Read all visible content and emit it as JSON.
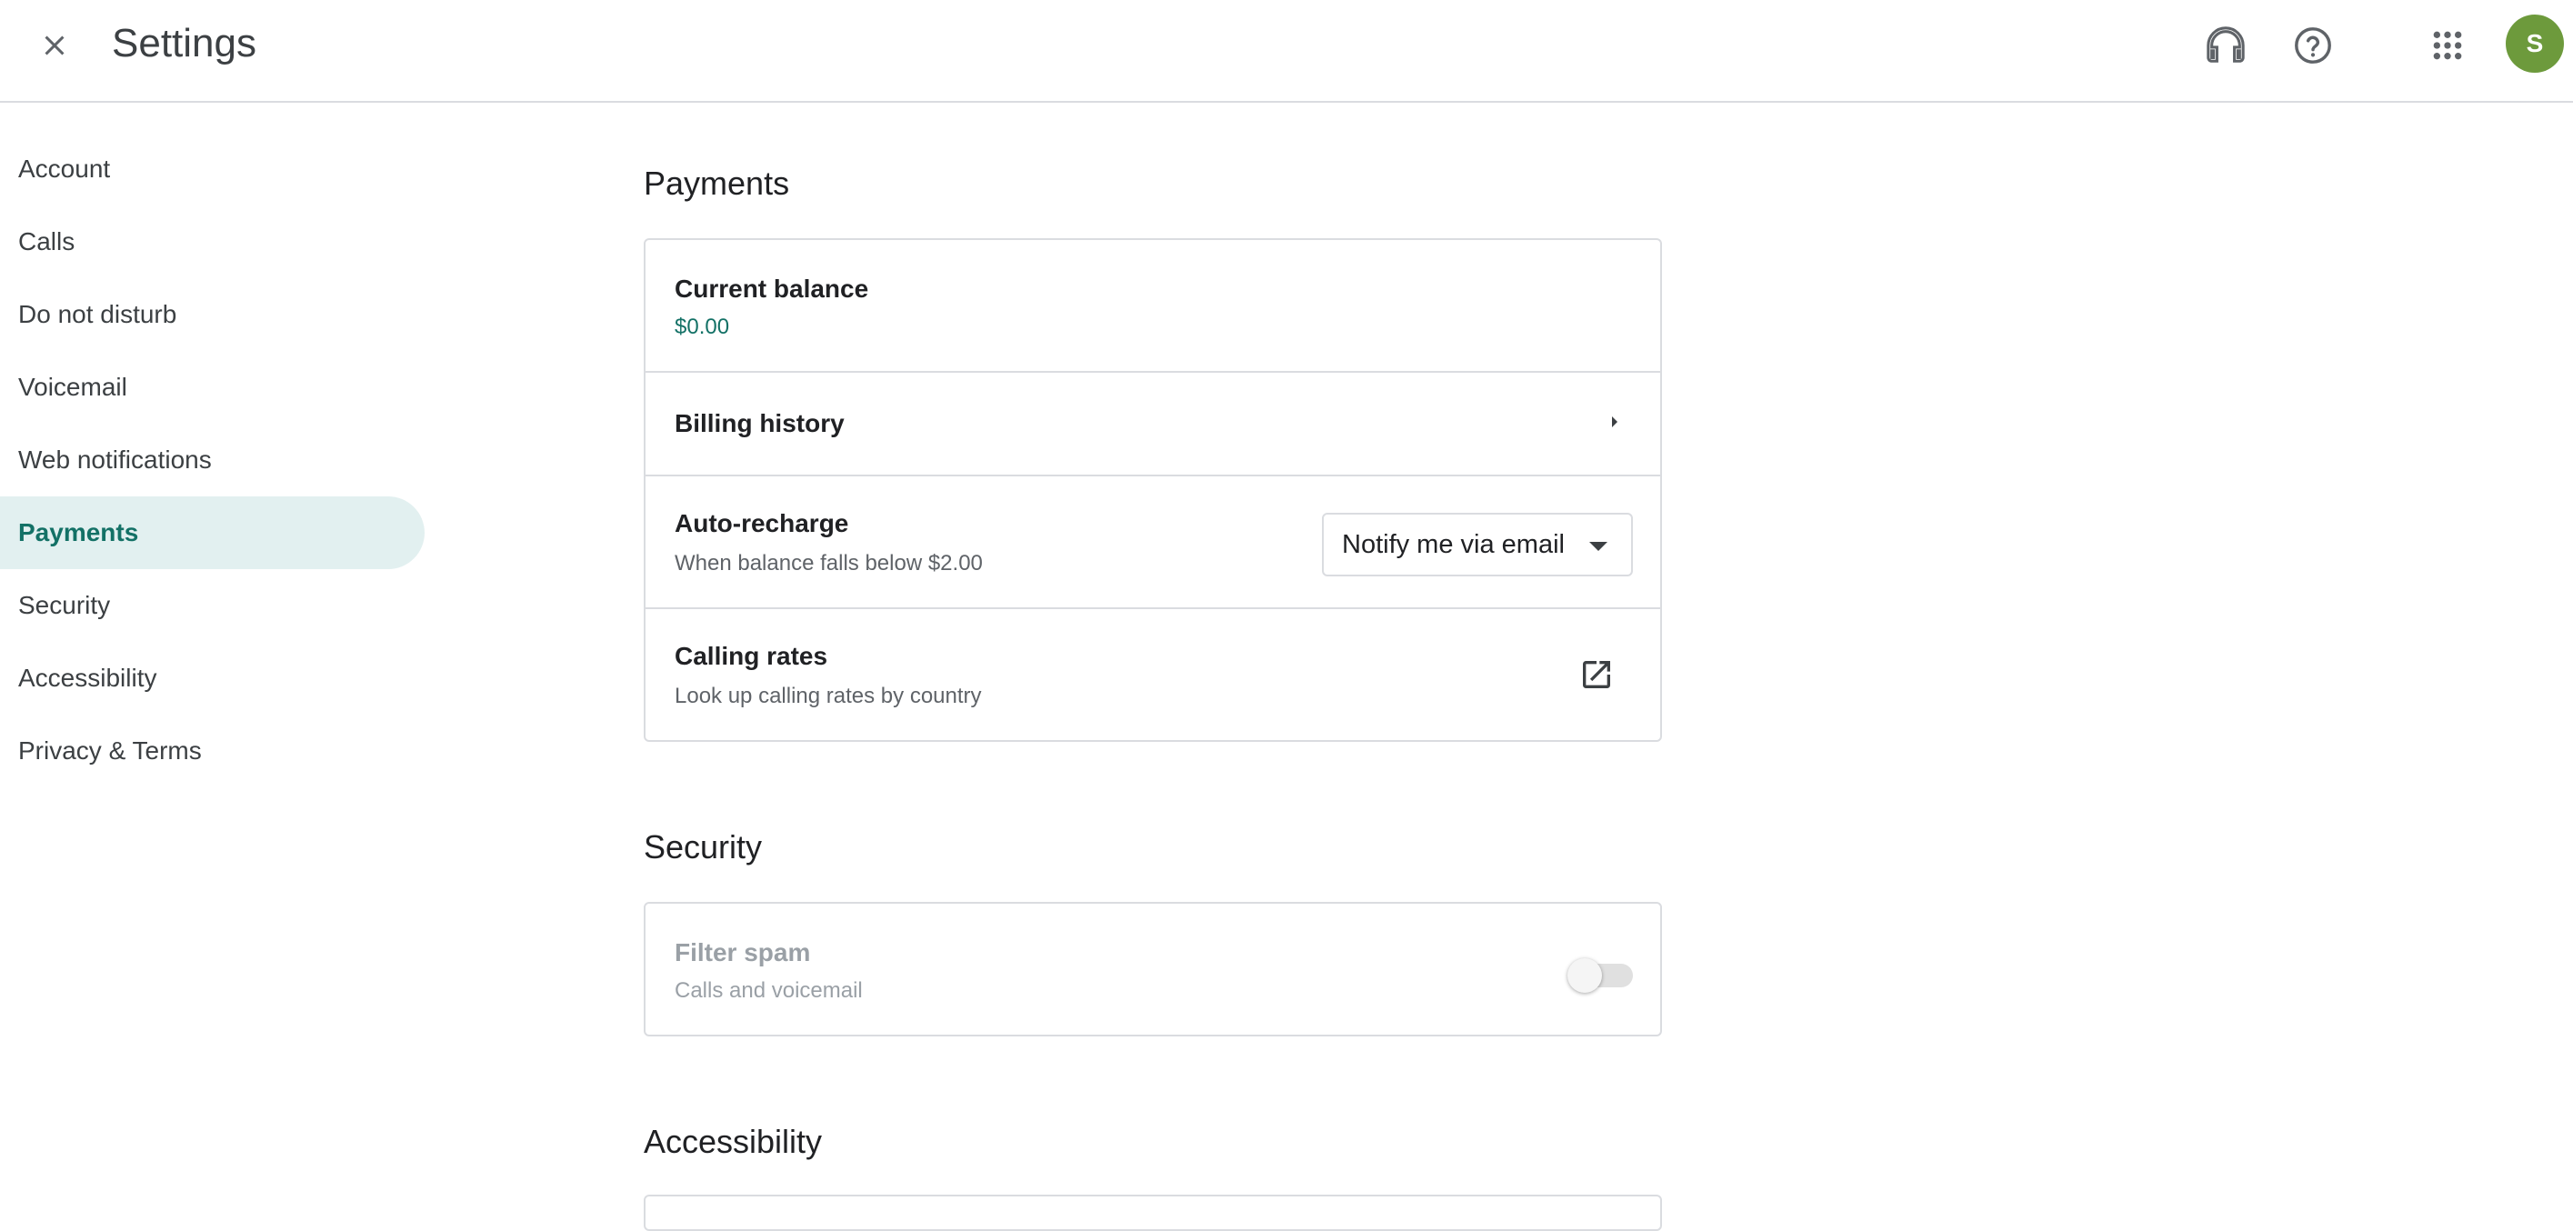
{
  "header": {
    "title": "Settings",
    "close_icon": "close-icon",
    "support_icon": "headset-icon",
    "help_icon": "help-icon",
    "apps_icon": "apps-grid-icon",
    "avatar_initial": "S",
    "avatar_color": "#6d9a3c"
  },
  "sidebar": {
    "items": [
      {
        "label": "Account"
      },
      {
        "label": "Calls"
      },
      {
        "label": "Do not disturb"
      },
      {
        "label": "Voicemail"
      },
      {
        "label": "Web notifications"
      },
      {
        "label": "Payments",
        "active": true
      },
      {
        "label": "Security"
      },
      {
        "label": "Accessibility"
      },
      {
        "label": "Privacy & Terms"
      }
    ],
    "active_color": "#137166",
    "active_bg": "#e2f0f0"
  },
  "payments": {
    "title": "Payments",
    "current_balance": {
      "label": "Current balance",
      "value": "$0.00"
    },
    "billing_history": {
      "label": "Billing history"
    },
    "auto_recharge": {
      "label": "Auto-recharge",
      "subtitle": "When balance falls below $2.00",
      "selected": "Notify me via email"
    },
    "calling_rates": {
      "label": "Calling rates",
      "subtitle": "Look up calling rates by country"
    }
  },
  "security": {
    "title": "Security",
    "filter_spam": {
      "label": "Filter spam",
      "subtitle": "Calls and voicemail",
      "enabled": false
    }
  },
  "accessibility": {
    "title": "Accessibility"
  }
}
